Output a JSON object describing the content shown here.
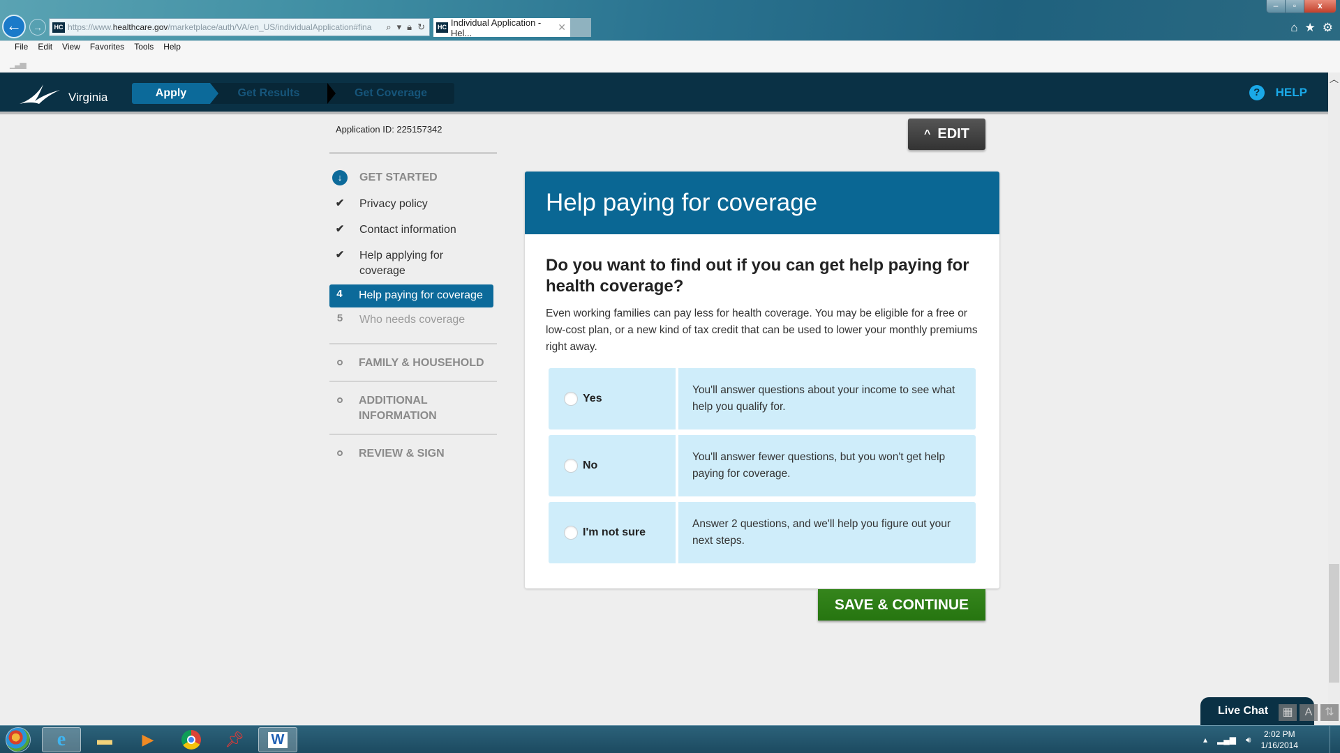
{
  "browser": {
    "url_prefix": "https://www.",
    "url_host": "healthcare.gov",
    "url_path": "/marketplace/auth/VA/en_US/individualApplication#fina",
    "favicon_text": "HC",
    "tab_title": "Individual Application - Hel...",
    "tab_close": "✕",
    "menu": [
      "File",
      "Edit",
      "View",
      "Favorites",
      "Tools",
      "Help"
    ],
    "window_controls": {
      "minimize": "–",
      "maximize": "▫",
      "close": "x"
    },
    "toolbar_icons": [
      "home-icon",
      "favorites-star-icon",
      "settings-gear-icon"
    ]
  },
  "header": {
    "state": "Virginia",
    "steps": [
      {
        "label": "Apply",
        "active": true
      },
      {
        "label": "Get Results",
        "active": false
      },
      {
        "label": "Get Coverage",
        "active": false
      }
    ],
    "help_label": "HELP",
    "help_icon": "?"
  },
  "application_id_label": "Application ID: 225157342",
  "edit_button": {
    "label": "EDIT",
    "icon": "^"
  },
  "sidebar": {
    "get_started": {
      "title": "GET STARTED",
      "items": [
        {
          "marker": "✔",
          "label": "Privacy policy",
          "status": "complete"
        },
        {
          "marker": "✔",
          "label": "Contact information",
          "status": "complete"
        },
        {
          "marker": "✔",
          "label": "Help applying for coverage",
          "status": "complete"
        },
        {
          "marker": "4",
          "label": "Help paying for coverage",
          "status": "current"
        },
        {
          "marker": "5",
          "label": "Who needs coverage",
          "status": "pending"
        }
      ]
    },
    "sections": [
      {
        "label": "FAMILY & HOUSEHOLD"
      },
      {
        "label": "ADDITIONAL INFORMATION"
      },
      {
        "label": "REVIEW & SIGN"
      }
    ]
  },
  "panel": {
    "title": "Help paying for coverage",
    "question": "Do you want to find out if you can get help paying for health coverage?",
    "description": "Even working families can pay less for health coverage. You may be eligible for a free or low-cost plan, or a new kind of tax credit that can be used to lower your monthly premiums right away.",
    "options": [
      {
        "label": "Yes",
        "detail": "You'll answer questions about your income to see what help you qualify for.",
        "selected": false
      },
      {
        "label": "No",
        "detail": "You'll answer fewer questions, but you won't get help paying for coverage.",
        "selected": false
      },
      {
        "label": "I'm not sure",
        "detail": "Answer 2 questions, and we'll help you figure out your next steps.",
        "selected": false
      }
    ]
  },
  "save_button": {
    "label": "SAVE & CONTINUE"
  },
  "live_chat": {
    "label": "Live Chat"
  },
  "taskbar": {
    "apps": [
      "start-button",
      "internet-explorer",
      "file-explorer",
      "media-player",
      "chrome",
      "sticky-pin",
      "microsoft-word"
    ],
    "clock_time": "2:02 PM",
    "clock_date": "1/16/2014"
  },
  "colors": {
    "nav_bg": "#0a3145",
    "primary_blue": "#0a6794",
    "help_blue": "#1aa9e8",
    "option_bg": "#cfedfa",
    "save_green": "#2d7d14"
  }
}
